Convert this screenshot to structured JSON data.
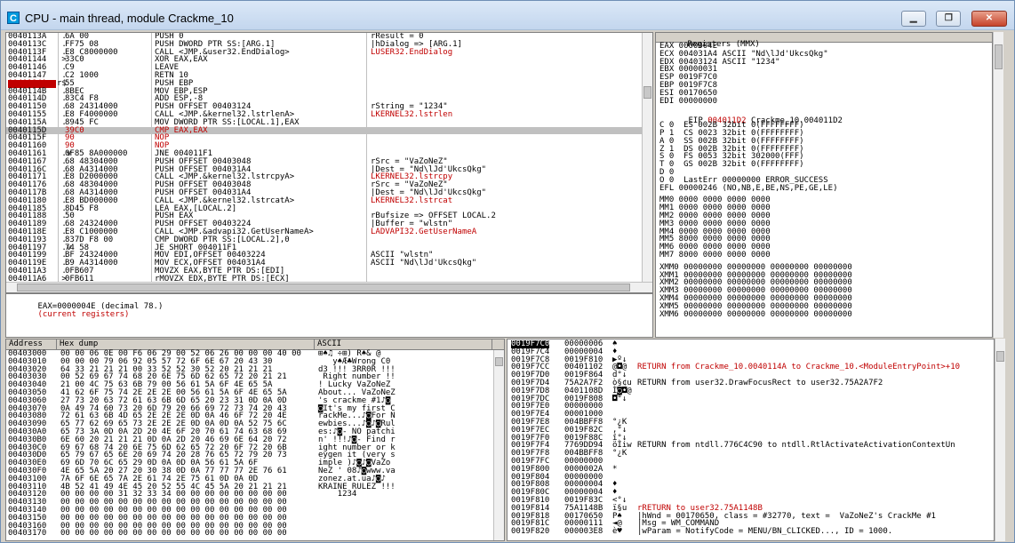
{
  "window": {
    "title": "CPU - main thread, module Crackme_10",
    "min": "▁",
    "max": "❐",
    "close": "✕"
  },
  "disasm": [
    {
      "addr": "0040113A",
      "bp": " .",
      "hex": "6A 00",
      "asm": "PUSH 0",
      "cmt": "rResult = 0",
      "hl": false,
      "red": false
    },
    {
      "addr": "0040113C",
      "bp": " .",
      "hex": "FF75 08",
      "asm": "PUSH DWORD PTR SS:[ARG.1]",
      "cmt": "|hDialog => [ARG.1]",
      "hl": false,
      "red": false
    },
    {
      "addr": "0040113F",
      "bp": " .",
      "hex": "E8 C8000000",
      "asm": "CALL <JMP.&user32.EndDialog>",
      "cmt": "LUSER32.EndDialog",
      "hl": false,
      "red": false,
      "cmtred": true
    },
    {
      "addr": "00401144",
      "bp": " >",
      "hex": "33C0",
      "asm": "XOR EAX,EAX",
      "cmt": "",
      "hl": false,
      "red": false
    },
    {
      "addr": "00401146",
      "bp": " .",
      "hex": "C9",
      "asm": "LEAVE",
      "cmt": "",
      "hl": false,
      "red": false
    },
    {
      "addr": "00401147",
      "bp": " .",
      "hex": "C2 1000",
      "asm": "RETN 10",
      "cmt": "",
      "hl": false,
      "red": false
    },
    {
      "addr": "0040114A",
      "bp": "r$",
      "hex": "55",
      "asm": "PUSH EBP",
      "cmt": "",
      "hl": false,
      "red": false,
      "bp_addr": true
    },
    {
      "addr": "0040114B",
      "bp": " .",
      "hex": "8BEC",
      "asm": "MOV EBP,ESP",
      "cmt": "",
      "hl": false,
      "red": false
    },
    {
      "addr": "0040114D",
      "bp": " .",
      "hex": "83C4 F8",
      "asm": "ADD ESP,-8",
      "cmt": "",
      "hl": false,
      "red": false
    },
    {
      "addr": "00401150",
      "bp": " .",
      "hex": "68 24314000",
      "asm": "PUSH OFFSET 00403124",
      "cmt": "rString = \"1234\"",
      "hl": false,
      "red": false
    },
    {
      "addr": "00401155",
      "bp": " .",
      "hex": "E8 F4000000",
      "asm": "CALL <JMP.&kernel32.lstrlenA>",
      "cmt": "LKERNEL32.lstrlen",
      "hl": false,
      "red": false,
      "cmtred": true
    },
    {
      "addr": "0040115A",
      "bp": " .",
      "hex": "8945 FC",
      "asm": "MOV DWORD PTR SS:[LOCAL.1],EAX",
      "cmt": "",
      "hl": false,
      "red": false
    },
    {
      "addr": "0040115D",
      "bp": "  ",
      "hex": "39C0",
      "asm": "CMP EAX,EAX",
      "cmt": "",
      "hl": true,
      "red": true
    },
    {
      "addr": "0040115F",
      "bp": "  ",
      "hex": "90",
      "asm": "NOP",
      "cmt": "",
      "hl": false,
      "red": true
    },
    {
      "addr": "00401160",
      "bp": "  ",
      "hex": "90",
      "asm": "NOP",
      "cmt": "",
      "hl": false,
      "red": true
    },
    {
      "addr": "00401161",
      "bp": " .v",
      "hex": "0F85 8A000000",
      "asm": "JNE 004011F1",
      "cmt": "",
      "hl": false,
      "red": false
    },
    {
      "addr": "00401167",
      "bp": " .",
      "hex": "68 48304000",
      "asm": "PUSH OFFSET 00403048",
      "cmt": "rSrc = \"VaZoNeZ\"",
      "hl": false,
      "red": false
    },
    {
      "addr": "0040116C",
      "bp": " .",
      "hex": "68 A4314000",
      "asm": "PUSH OFFSET 004031A4",
      "cmt": "|Dest = \"Nd\\lJd'UkcsQkg\"",
      "hl": false,
      "red": false
    },
    {
      "addr": "00401171",
      "bp": " .",
      "hex": "E8 D2000000",
      "asm": "CALL <JMP.&kernel32.lstrcpyA>",
      "cmt": "LKERNEL32.lstrcpy",
      "hl": false,
      "red": false,
      "cmtred": true
    },
    {
      "addr": "00401176",
      "bp": " .",
      "hex": "68 48304000",
      "asm": "PUSH OFFSET 00403048",
      "cmt": "rSrc = \"VaZoNeZ\"",
      "hl": false,
      "red": false
    },
    {
      "addr": "0040117B",
      "bp": " .",
      "hex": "68 A4314000",
      "asm": "PUSH OFFSET 004031A4",
      "cmt": "|Dest = \"Nd\\lJd'UkcsQkg\"",
      "hl": false,
      "red": false
    },
    {
      "addr": "00401180",
      "bp": " .",
      "hex": "E8 BD000000",
      "asm": "CALL <JMP.&kernel32.lstrcatA>",
      "cmt": "LKERNEL32.lstrcat",
      "hl": false,
      "red": false,
      "cmtred": true
    },
    {
      "addr": "00401185",
      "bp": " .",
      "hex": "8D45 F8",
      "asm": "LEA EAX,[LOCAL.2]",
      "cmt": "",
      "hl": false,
      "red": false
    },
    {
      "addr": "00401188",
      "bp": " .",
      "hex": "50",
      "asm": "PUSH EAX",
      "cmt": "rBufsize => OFFSET LOCAL.2",
      "hl": false,
      "red": false
    },
    {
      "addr": "00401189",
      "bp": " .",
      "hex": "68 24324000",
      "asm": "PUSH OFFSET 00403224",
      "cmt": "|Buffer = \"wlstn\"",
      "hl": false,
      "red": false
    },
    {
      "addr": "0040118E",
      "bp": " .",
      "hex": "E8 C1000000",
      "asm": "CALL <JMP.&advapi32.GetUserNameA>",
      "cmt": "LADVAPI32.GetUserNameA",
      "hl": false,
      "red": false,
      "cmtred": true
    },
    {
      "addr": "00401193",
      "bp": " .",
      "hex": "837D F8 00",
      "asm": "CMP DWORD PTR SS:[LOCAL.2],0",
      "cmt": "",
      "hl": false,
      "red": false
    },
    {
      "addr": "00401197",
      "bp": " .v",
      "hex": "74 58",
      "asm": "JE SHORT 004011F1",
      "cmt": "",
      "hl": false,
      "red": false
    },
    {
      "addr": "00401199",
      "bp": " .",
      "hex": "BF 24324000",
      "asm": "MOV EDI,OFFSET 00403224",
      "cmt": "ASCII \"wlstn\"",
      "hl": false,
      "red": false
    },
    {
      "addr": "0040119E",
      "bp": " .",
      "hex": "B9 A4314000",
      "asm": "MOV ECX,OFFSET 004031A4",
      "cmt": "ASCII \"Nd\\lJd'UkcsQkg\"",
      "hl": false,
      "red": false
    },
    {
      "addr": "004011A3",
      "bp": " .",
      "hex": "0FB607",
      "asm": "MOVZX EAX,BYTE PTR DS:[EDI]",
      "cmt": "",
      "hl": false,
      "red": false
    },
    {
      "addr": "004011A6",
      "bp": " >",
      "hex": "0FB611",
      "asm": "rMOVZX EDX,BYTE PTR DS:[ECX]",
      "cmt": "",
      "hl": false,
      "red": false
    },
    {
      "addr": "004011A9",
      "bp": " .",
      "hex": "85D2",
      "asm": "|TEST EDX,EDX",
      "cmt": "",
      "hl": false,
      "red": false
    }
  ],
  "info": {
    "line": "EAX=0000004E (decimal 78.)",
    "tag": "(current registers)"
  },
  "registers": {
    "header": "Registers (MMX)",
    "gp": [
      "EAX 0000004E",
      "ECX 004031A4 ASCII \"Nd\\lJd'UkcsQkg\"",
      "EDX 00403124 ASCII \"1234\"",
      "EBX 00000031",
      "ESP 0019F7C0",
      "EBP 0019F7C8",
      "ESI 00170650",
      "EDI 00000000"
    ],
    "eip_label": "EIP",
    "eip_value": "004011D2",
    "eip_desc": "Crackme_10.004011D2",
    "flags": [
      "C 0  ES 002B 32bit 0(FFFFFFFF)",
      "P 1  CS 0023 32bit 0(FFFFFFFF)",
      "A 0  SS 002B 32bit 0(FFFFFFFF)",
      "Z 1  DS 002B 32bit 0(FFFFFFFF)",
      "S 0  FS 0053 32bit 302000(FFF)",
      "T 0  GS 002B 32bit 0(FFFFFFFF)",
      "D 0",
      "O 0  LastErr 00000000 ERROR_SUCCESS"
    ],
    "efl": "EFL 00000246 (NO,NB,E,BE,NS,PE,GE,LE)",
    "mm": [
      "MM0 0000 0000 0000 0000",
      "MM1 0000 0000 0000 0000",
      "MM2 0000 0000 0000 0000",
      "MM3 0000 0000 0000 0000",
      "MM4 0000 0000 0000 0000",
      "MM5 8000 0000 0000 0000",
      "MM6 0000 0000 0000 0000",
      "MM7 8000 0000 0000 0000"
    ],
    "xmm": [
      "XMM0 00000000 00000000 00000000 00000000",
      "XMM1 00000000 00000000 00000000 00000000",
      "XMM2 00000000 00000000 00000000 00000000",
      "XMM3 00000000 00000000 00000000 00000000",
      "XMM4 00000000 00000000 00000000 00000000",
      "XMM5 00000000 00000000 00000000 00000000",
      "XMM6 00000000 00000000 00000000 00000000"
    ]
  },
  "dump": {
    "col_address": "Address",
    "col_hex": "Hex dump",
    "col_ascii": "ASCII",
    "rows": [
      {
        "a": "00403000",
        "h": "00 00 06 0E 00 F6 06 29 00 52 06 26 00 00 00 40 00",
        "s": "⊞♠♫ ÷⊞) R♠& @"
      },
      {
        "a": "00403010",
        "h": "00 00 00 79 06 92 05 57 72 6F 6E 67 20 43 30",
        "s": "   y♠Æ♣Wrong C0"
      },
      {
        "a": "00403020",
        "h": "64 33 21 21 21 00 33 52 52 30 52 20 21 21 21",
        "s": "d3 !!! 3RR0R !!!"
      },
      {
        "a": "00403030",
        "h": "00 52 69 67 74 68 20 6E 75 6D 62 65 72 20 21 21",
        "s": " Right number !!"
      },
      {
        "a": "00403040",
        "h": "21 00 4C 75 63 6B 79 00 56 61 5A 6F 4E 65 5A",
        "s": "! Lucky VaZoNeZ"
      },
      {
        "a": "00403050",
        "h": "41 62 6F 75 74 2E 2E 2E 00 56 61 5A 6F 4E 65 5A",
        "s": "About... VaZoNeZ"
      },
      {
        "a": "00403060",
        "h": "27 73 20 63 72 61 63 6B 6D 65 20 23 31 0D 0A 0D",
        "s": "'s crackme #1♪◙"
      },
      {
        "a": "00403070",
        "h": "0A 49 74 60 73 20 6D 79 20 66 69 72 73 74 20 43",
        "s": "◙It's my first C"
      },
      {
        "a": "00403080",
        "h": "72 61 63 6B 4D 65 2E 2E 2E 0D 0A 46 6F 72 20 4E",
        "s": "rackMe...♪◙For N"
      },
      {
        "a": "00403090",
        "h": "65 77 62 69 65 73 2E 2E 2E 0D 0A 0D 0A 52 75 6C",
        "s": "ewbies...♪◙♪◙Rul"
      },
      {
        "a": "004030A0",
        "h": "65 73 3A 0D 0A 2D 20 4E 6F 20 70 61 74 63 68 69",
        "s": "es:♪◙- NO patchi"
      },
      {
        "a": "004030B0",
        "h": "6E 60 20 21 21 21 0D 0A 2D 20 46 69 6E 64 20 72",
        "s": "n' !!!♪◙- Find r"
      },
      {
        "a": "004030C0",
        "h": "69 67 68 74 20 6E 75 6D 62 65 72 20 6F 72 20 6B",
        "s": "ight number or k"
      },
      {
        "a": "004030D0",
        "h": "65 79 67 65 6E 20 69 74 20 28 76 65 72 79 20 73",
        "s": "eygen it (very s"
      },
      {
        "a": "004030E0",
        "h": "69 6D 70 6C 65 29 0D 0A 0D 0A 56 61 5A 6F",
        "s": "imple )♪◙♪◙VaZo"
      },
      {
        "a": "004030F0",
        "h": "4E 65 5A 20 27 20 30 38 0D 0A 77 77 77 2E 76 61",
        "s": "NeZ ' 08♪◙www.va"
      },
      {
        "a": "00403100",
        "h": "7A 6F 6E 65 7A 2E 61 74 2E 75 61 0D 0A 0D",
        "s": "zonez.at.ua♪◙♪"
      },
      {
        "a": "00403110",
        "h": "4B 52 41 49 4E 45 20 52 55 4C 45 5A 20 21 21 21",
        "s": "KRAINE RULEZ !!!"
      },
      {
        "a": "00403120",
        "h": "00 00 00 00 31 32 33 34 00 00 00 00 00 00 00 00",
        "s": "    1234"
      },
      {
        "a": "00403130",
        "h": "00 00 00 00 00 00 00 00 00 00 00 00 00 00 00 00",
        "s": ""
      },
      {
        "a": "00403140",
        "h": "00 00 00 00 00 00 00 00 00 00 00 00 00 00 00 00",
        "s": ""
      },
      {
        "a": "00403150",
        "h": "00 00 00 00 00 00 00 00 00 00 00 00 00 00 00 00",
        "s": ""
      },
      {
        "a": "00403160",
        "h": "00 00 00 00 00 00 00 00 00 00 00 00 00 00 00 00",
        "s": ""
      },
      {
        "a": "00403170",
        "h": "00 00 00 00 00 00 00 00 00 00 00 00 00 00 00 00",
        "s": ""
      }
    ]
  },
  "stack": [
    {
      "a": "0019F7C0",
      "v": "00000006",
      "c": "♠",
      "cm": "",
      "sel": true
    },
    {
      "a": "0019F7C4",
      "v": "00000004",
      "c": "♦",
      "cm": ""
    },
    {
      "a": "0019F7C8",
      "v": "0019F810",
      "c": "▶º↓",
      "cm": ""
    },
    {
      "a": "0019F7CC",
      "v": "00401102",
      "c": "@◘@",
      "cm": "RETURN from Crackme_10.0040114A to Crackme_10.<ModuleEntryPoint>+10",
      "cmred": true
    },
    {
      "a": "0019F7D0",
      "v": "0019F864",
      "c": "d°↓",
      "cm": ""
    },
    {
      "a": "0019F7D4",
      "v": "75A2A7F2",
      "c": "ò§¢u",
      "cm": "RETURN from user32.DrawFocusRect to user32.75A2A7F2"
    },
    {
      "a": "0019F7D8",
      "v": "0401108D",
      "c": "Ì◙◘@",
      "cm": ""
    },
    {
      "a": "0019F7DC",
      "v": "0019F808",
      "c": "◘°↓",
      "cm": ""
    },
    {
      "a": "0019F7E0",
      "v": "00000000",
      "c": "",
      "cm": ""
    },
    {
      "a": "0019F7E4",
      "v": "00001000",
      "c": "",
      "cm": ""
    },
    {
      "a": "0019F7E8",
      "v": "004BBFF8",
      "c": "°¿K",
      "cm": ""
    },
    {
      "a": "0019F7EC",
      "v": "0019F82C",
      "c": ",°↓",
      "cm": ""
    },
    {
      "a": "0019F7F0",
      "v": "0019F88C",
      "c": "î°↓",
      "cm": ""
    },
    {
      "a": "0019F7F4",
      "v": "7769DD94",
      "c": "öÌiw",
      "cm": "RETURN from ntdll.776C4C90 to ntdll.RtlActivateActivationContextUn"
    },
    {
      "a": "0019F7F8",
      "v": "004BBFF8",
      "c": "°¿K",
      "cm": ""
    },
    {
      "a": "0019F7FC",
      "v": "00000000",
      "c": "",
      "cm": ""
    },
    {
      "a": "0019F800",
      "v": "0000002A",
      "c": "*",
      "cm": ""
    },
    {
      "a": "0019F804",
      "v": "00000000",
      "c": "",
      "cm": ""
    },
    {
      "a": "0019F808",
      "v": "00000004",
      "c": "♦",
      "cm": ""
    },
    {
      "a": "0019F80C",
      "v": "00000004",
      "c": "♦",
      "cm": ""
    },
    {
      "a": "0019F810",
      "v": "0019F83C",
      "c": "<°↓",
      "cm": ""
    },
    {
      "a": "0019F814",
      "v": "75A1148B",
      "c": "ï§u",
      "cm": "rRETURN to user32.75A1148B",
      "cmred": true
    },
    {
      "a": "0019F818",
      "v": "00170650",
      "c": "P♠",
      "cm": "|hWnd = 00170650, class = #32770, text =  VaZoNeZ's CrackMe #1"
    },
    {
      "a": "0019F81C",
      "v": "00000111",
      "c": "◄@",
      "cm": "|Msg = WM_COMMAND"
    },
    {
      "a": "0019F820",
      "v": "000003E8",
      "c": "è♥",
      "cm": "|wParam = NotifyCode = MENU/BN_CLICKED..., ID = 1000."
    }
  ]
}
